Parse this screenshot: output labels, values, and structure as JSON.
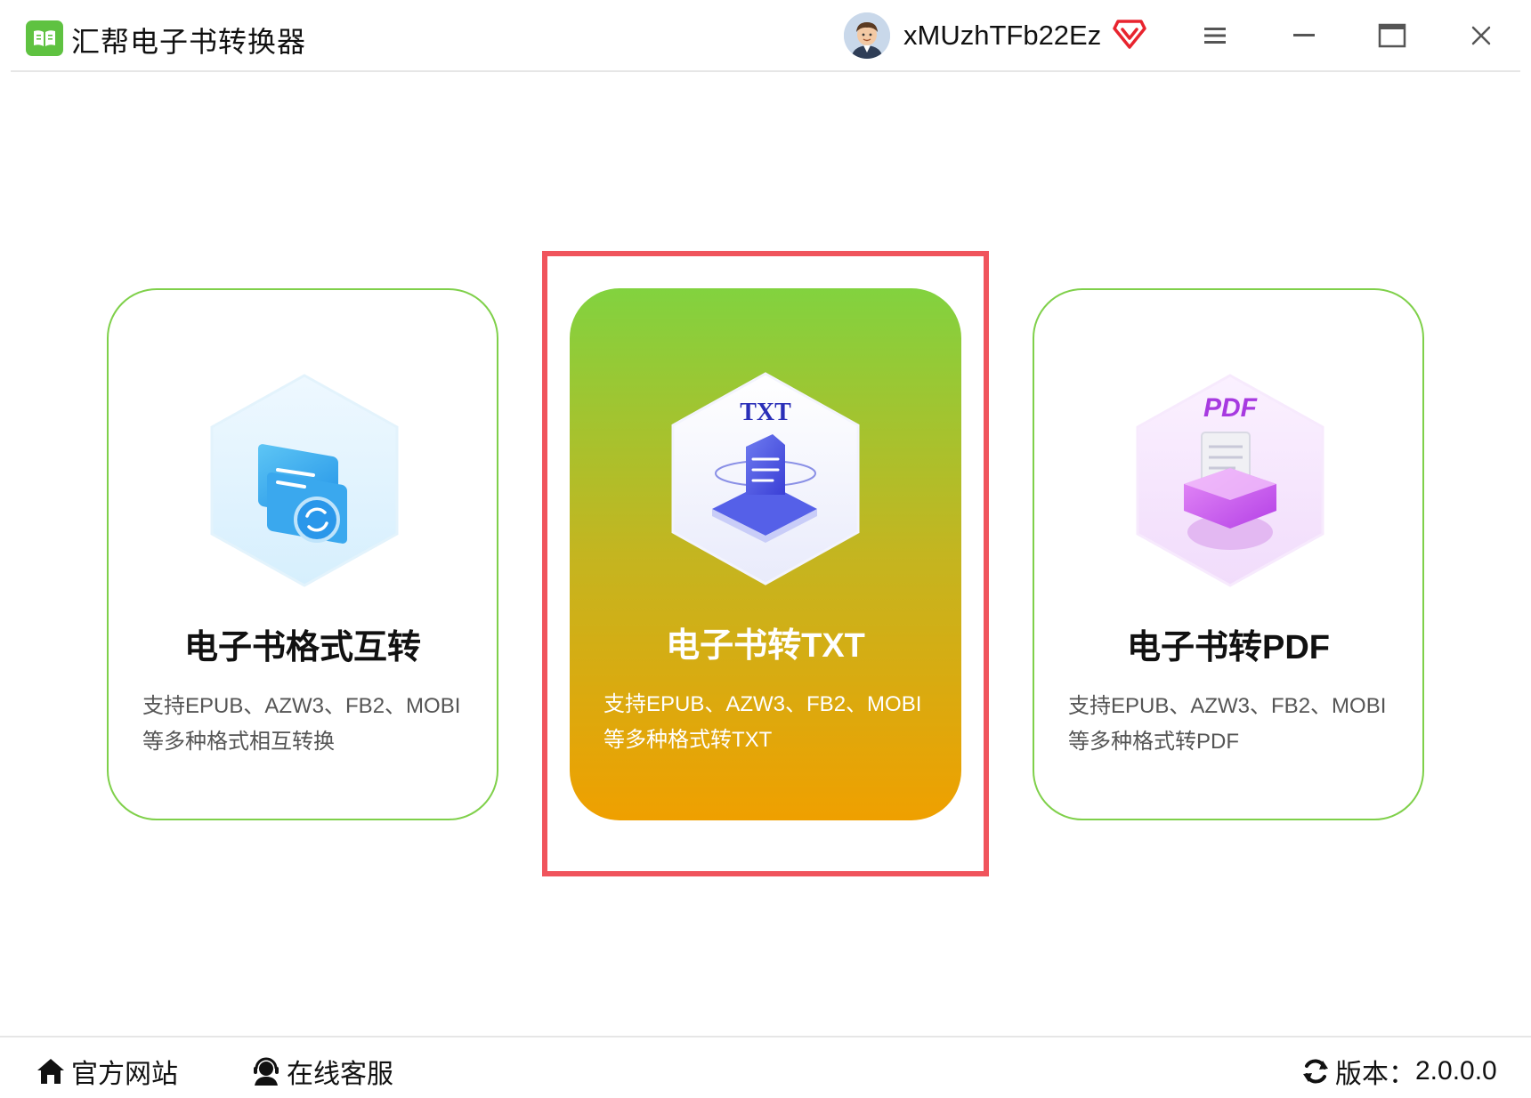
{
  "app": {
    "title": "汇帮电子书转换器"
  },
  "user": {
    "name": "xMUzhTFb22Ez"
  },
  "window_controls": [
    "menu-icon",
    "minimize-icon",
    "maximize-icon",
    "close-icon"
  ],
  "cards": [
    {
      "title": "电子书格式互转",
      "desc_line1": "支持EPUB、AZW3、FB2、MOBI",
      "desc_line2": "等多种格式相互转换",
      "icon": "format-convert-icon"
    },
    {
      "title": "电子书转TXT",
      "desc_line1": "支持EPUB、AZW3、FB2、MOBI",
      "desc_line2": "等多种格式转TXT",
      "icon": "txt-icon",
      "icon_label": "TXT"
    },
    {
      "title": "电子书转PDF",
      "desc_line1": "支持EPUB、AZW3、FB2、MOBI",
      "desc_line2": "等多种格式转PDF",
      "icon": "pdf-icon",
      "icon_label": "PDF"
    }
  ],
  "footer": {
    "website": "官方网站",
    "support": "在线客服",
    "version_label": "版本：",
    "version": "2.0.0.0"
  },
  "colors": {
    "accent_green": "#5fc241",
    "card_border": "#7fd04a",
    "highlight_red": "#f0545c",
    "gradient_top": "#82d23f",
    "gradient_bottom": "#efa000"
  }
}
